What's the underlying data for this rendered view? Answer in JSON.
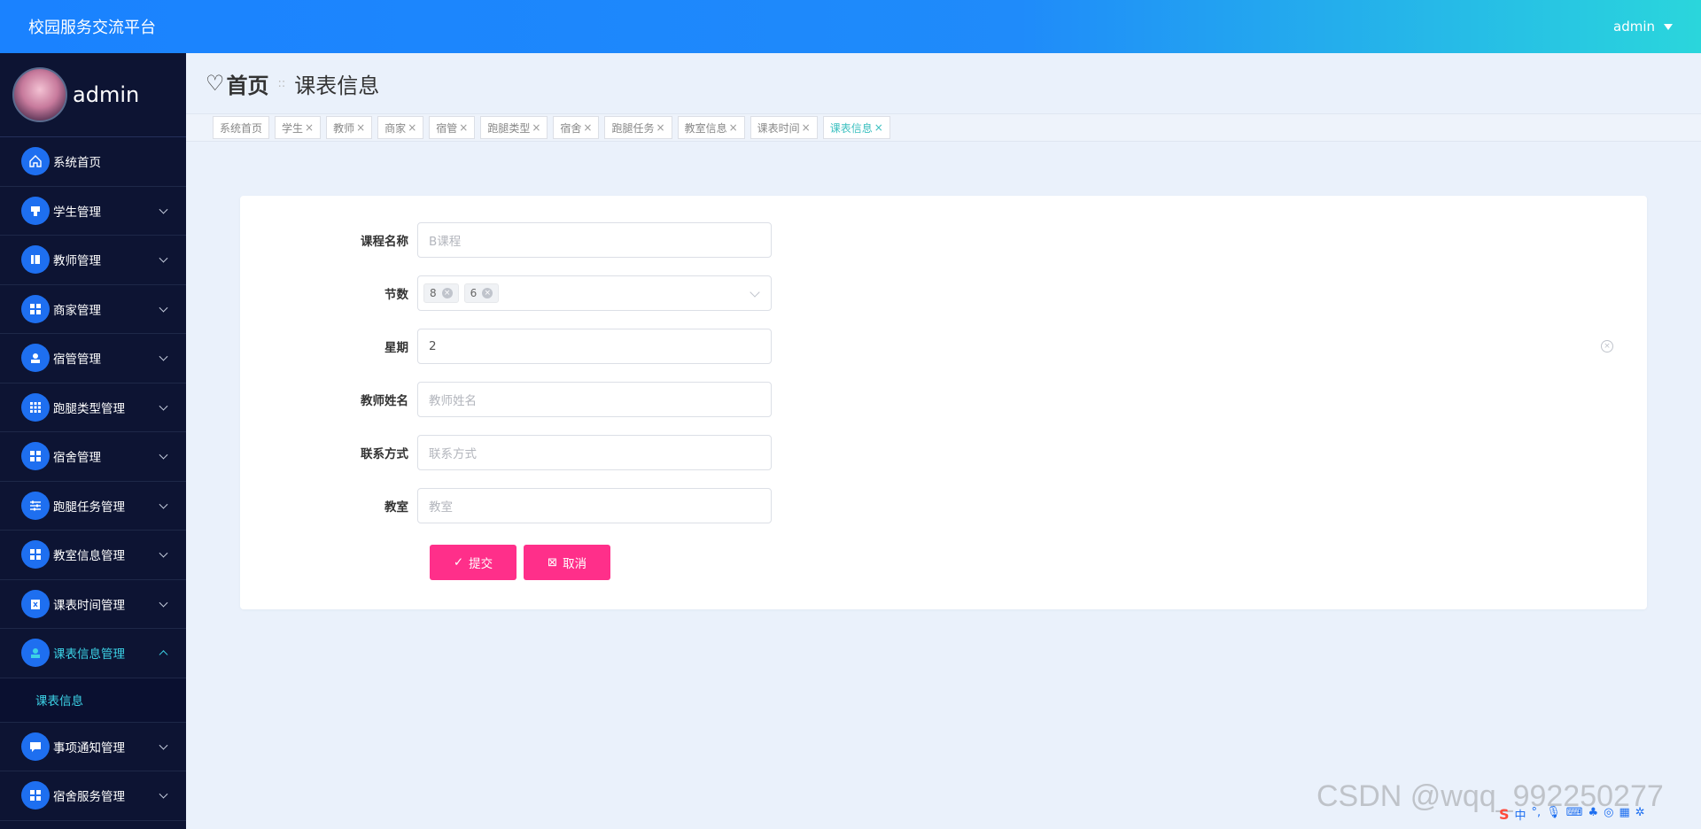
{
  "app": {
    "title": "校园服务交流平台",
    "user": "admin"
  },
  "sidebar": {
    "profile_name": "admin",
    "items": [
      {
        "label": "系统首页"
      },
      {
        "label": "学生管理"
      },
      {
        "label": "教师管理"
      },
      {
        "label": "商家管理"
      },
      {
        "label": "宿管管理"
      },
      {
        "label": "跑腿类型管理"
      },
      {
        "label": "宿舍管理"
      },
      {
        "label": "跑腿任务管理"
      },
      {
        "label": "教室信息管理"
      },
      {
        "label": "课表时间管理"
      },
      {
        "label": "课表信息管理"
      },
      {
        "label": "事项通知管理"
      },
      {
        "label": "宿舍服务管理"
      }
    ],
    "sub_item": "课表信息"
  },
  "breadcrumb": {
    "home": "首页",
    "separator": "::",
    "current": "课表信息"
  },
  "tabs": [
    {
      "label": "系统首页"
    },
    {
      "label": "学生"
    },
    {
      "label": "教师"
    },
    {
      "label": "商家"
    },
    {
      "label": "宿管"
    },
    {
      "label": "跑腿类型"
    },
    {
      "label": "宿舍"
    },
    {
      "label": "跑腿任务"
    },
    {
      "label": "教室信息"
    },
    {
      "label": "课表时间"
    },
    {
      "label": "课表信息"
    }
  ],
  "form": {
    "course_name": {
      "label": "课程名称",
      "placeholder": "B课程"
    },
    "sessions": {
      "label": "节数",
      "tags": [
        "8",
        "6"
      ]
    },
    "weekday": {
      "label": "星期",
      "value": "2"
    },
    "teacher": {
      "label": "教师姓名",
      "placeholder": "教师姓名"
    },
    "contact": {
      "label": "联系方式",
      "placeholder": "联系方式"
    },
    "classroom": {
      "label": "教室",
      "placeholder": "教室"
    },
    "submit_label": "提交",
    "cancel_label": "取消"
  },
  "watermark": "CSDN @wqq_992250277",
  "colors": {
    "accent": "#ff2f8a",
    "sidebar_bg": "#0d1433",
    "active_text": "#3cd2e6",
    "icon_bg": "#1e6ff0"
  }
}
